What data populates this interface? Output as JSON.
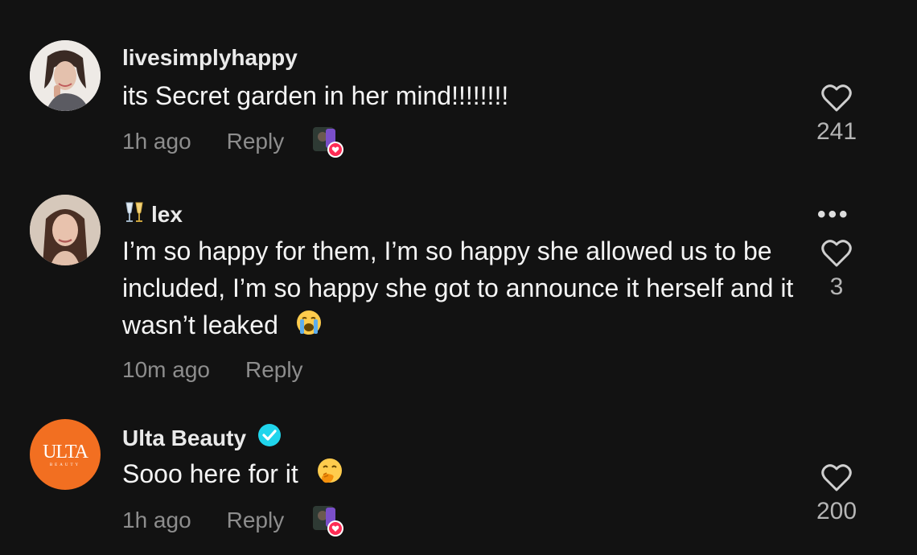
{
  "comments": [
    {
      "username": "livesimplyhappy",
      "text": "its Secret garden in her mind!!!!!!!!",
      "time": "1h ago",
      "reply": "Reply",
      "likes": "241",
      "creator_liked": true
    },
    {
      "username": "lex",
      "username_emoji": "clinking-glasses",
      "text": "I’m so happy for them, I’m so happy she allowed us to be included, I’m so happy she got to announce it herself and it wasn’t leaked",
      "text_emoji": "loudly-crying-face",
      "time": "10m ago",
      "reply": "Reply",
      "likes": "3",
      "more": "•••"
    },
    {
      "username": "Ulta Beauty",
      "verified": true,
      "avatar_text": "ULTA",
      "avatar_subtext": "BEAUTY",
      "text": "Sooo here for it",
      "text_emoji": "face-with-hand-over-mouth",
      "time": "1h ago",
      "reply": "Reply",
      "likes": "200",
      "creator_liked": true
    }
  ],
  "colors": {
    "background": "#121212",
    "meta_text": "#8d8d8d",
    "verified": "#20d5ec",
    "ulta_orange": "#f26f21",
    "liked_badge": "#fe2c55"
  }
}
